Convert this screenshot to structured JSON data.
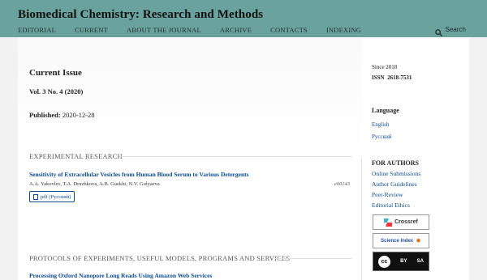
{
  "header": {
    "site_title": "Biomedical Chemistry: Research and Methods",
    "nav": [
      "EDITORIAL",
      "CURRENT",
      "ABOUT THE JOURNAL",
      "ARCHIVE",
      "CONTACTS",
      "INDEXING"
    ],
    "search_label": "Search",
    "bg_color": "#6aa39e"
  },
  "main": {
    "current_issue": "Current Issue",
    "volume": "Vol. 3 No. 4 (2020)",
    "published_label": "Published:",
    "published_date": "2020-12-28",
    "sections": [
      {
        "title": "EXPERIMENTAL RESEARCH",
        "article": {
          "title": "Sensitivity of Extracellular Vesicles from Human Blood Serum to Various Detergents",
          "authors": "A.A. Yakovlev, T.A. Druzhkova, A.B. Guekht, N.V. Gulyaeva",
          "pages": "e00143",
          "pdf_label": "pdf (Русский)"
        }
      },
      {
        "title": "PROTOCOLS OF EXPERIMENTS, USEFUL MODELS, PROGRAMS AND SERVICES",
        "article": {
          "title": "Processing Oxford Nanopore Long Reads Using Amazon Web Services"
        }
      }
    ]
  },
  "sidebar": {
    "since": "Since 2018",
    "issn_label": "ISSN",
    "issn_value": "2618-7531",
    "language_heading": "Language",
    "languages": [
      "English",
      "Русский"
    ],
    "for_authors_heading": "FOR AUTHORS",
    "for_authors_links": [
      "Online Submissions",
      "Author Guidelines",
      "Peer-Review",
      "Editorial Ethics"
    ],
    "badges": {
      "crossref": "Crossref",
      "science_index": "Science Index",
      "cc": [
        "cc",
        "BY",
        "SA"
      ]
    }
  }
}
